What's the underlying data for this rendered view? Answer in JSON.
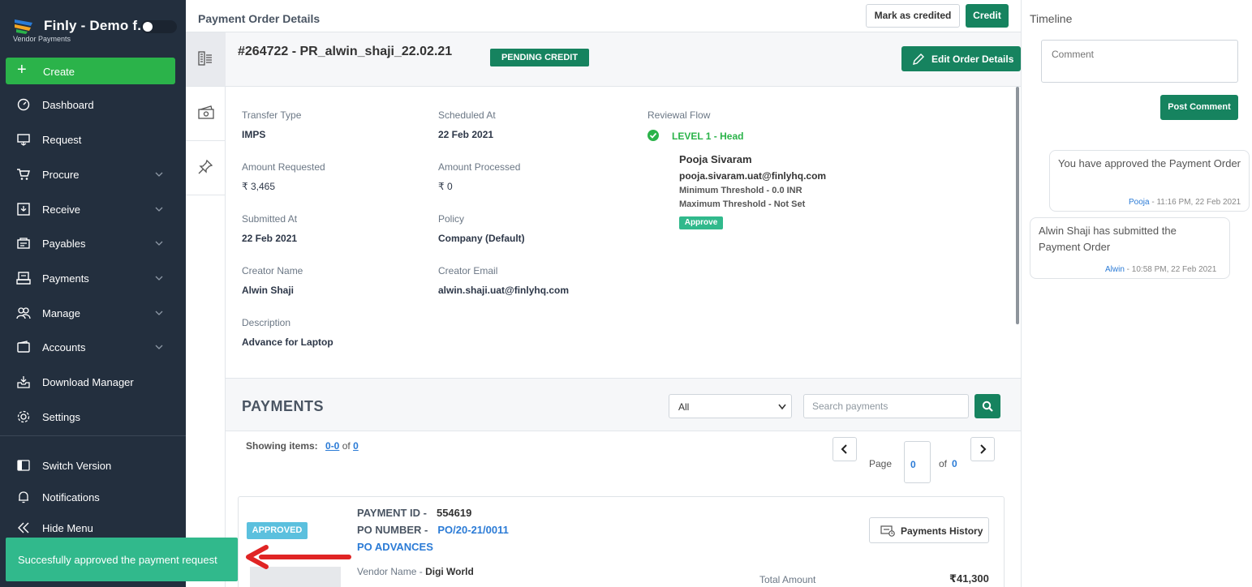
{
  "sidebar": {
    "brand_title": "Finly - Demo f...",
    "brand_subtitle": "Vendor Payments",
    "create_label": "Create",
    "items": [
      {
        "label": "Dashboard"
      },
      {
        "label": "Request"
      },
      {
        "label": "Procure"
      },
      {
        "label": "Receive"
      },
      {
        "label": "Payables"
      },
      {
        "label": "Payments"
      },
      {
        "label": "Manage"
      },
      {
        "label": "Accounts"
      },
      {
        "label": "Download Manager"
      },
      {
        "label": "Settings"
      }
    ],
    "bottom_items": [
      {
        "label": "Switch Version"
      },
      {
        "label": "Notifications"
      },
      {
        "label": "Hide Menu"
      }
    ],
    "bg_color": "#232f3e",
    "accent_color": "#2bb34a"
  },
  "toast": {
    "message": "Succesfully approved the payment request",
    "color": "#31b98c"
  },
  "header": {
    "title": "Payment Order Details",
    "mark_credited_label": "Mark as credited",
    "credit_label": "Credit"
  },
  "order": {
    "id_title": "#264722 - PR_alwin_shaji_22.02.21",
    "status_badge": "PENDING CREDIT",
    "edit_label": "Edit Order Details",
    "fields": {
      "transfer_type_label": "Transfer Type",
      "transfer_type": "IMPS",
      "scheduled_at_label": "Scheduled At",
      "scheduled_at": "22 Feb 2021",
      "amount_requested_label": "Amount Requested",
      "amount_requested": "₹ 3,465",
      "amount_processed_label": "Amount Processed",
      "amount_processed": "₹ 0",
      "submitted_at_label": "Submitted At",
      "submitted_at": "22 Feb 2021",
      "policy_label": "Policy",
      "policy": "Company (Default)",
      "creator_name_label": "Creator Name",
      "creator_name": "Alwin Shaji",
      "creator_email_label": "Creator Email",
      "creator_email": "alwin.shaji.uat@finlyhq.com",
      "description_label": "Description",
      "description": "Advance for Laptop"
    },
    "review": {
      "label": "Reviewal Flow",
      "level": "LEVEL 1 -  Head",
      "name": "Pooja Sivaram",
      "email": "pooja.sivaram.uat@finlyhq.com",
      "min_threshold": "Minimum Threshold -  0.0 INR",
      "max_threshold": "Maximum Threshold -  Not Set",
      "badge": "Approve"
    }
  },
  "payments": {
    "title": "PAYMENTS",
    "filter_value": "All",
    "search_placeholder": "Search payments",
    "showing_label": "Showing items:",
    "showing_range": "0-0",
    "showing_of": "of",
    "showing_total": "0",
    "page_label": "Page",
    "page_value": "0",
    "of_label": "of",
    "page_total": "0",
    "card": {
      "status": "APPROVED",
      "payment_id_label": "PAYMENT ID -",
      "payment_id": "554619",
      "po_number_label": "PO NUMBER -",
      "po_number": "PO/20-21/0011",
      "po_type": "PO ADVANCES",
      "vendor_label": "Vendor Name -",
      "vendor": "Digi World",
      "history_label": "Payments History",
      "total_label": "Total Amount",
      "total_value": "₹41,300"
    }
  },
  "timeline": {
    "title": "Timeline",
    "comment_placeholder": "Comment",
    "post_label": "Post Comment",
    "entries": [
      {
        "message": "You have approved the Payment Order",
        "author": "Pooja",
        "time": " - 11:16 PM, 22 Feb 2021"
      },
      {
        "message": "Alwin Shaji has submitted the Payment Order",
        "author": "Alwin",
        "time": " - 10:58 PM, 22 Feb 2021"
      }
    ]
  }
}
